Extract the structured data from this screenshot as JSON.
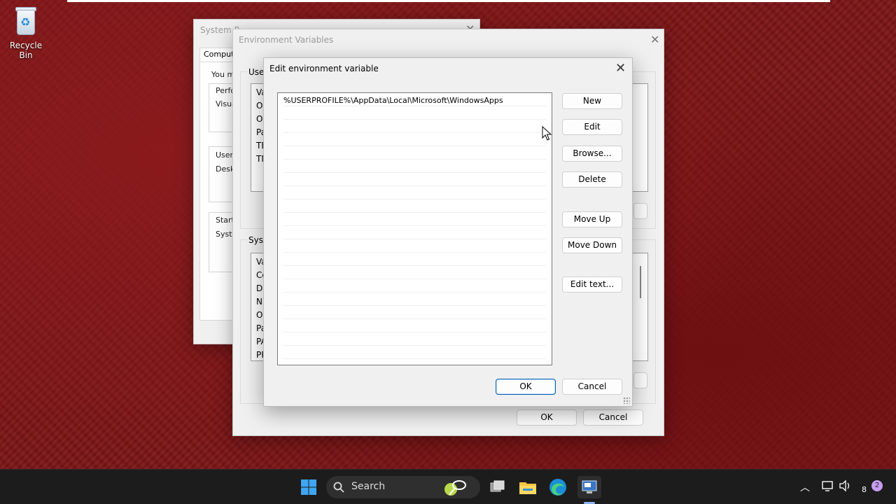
{
  "desktop": {
    "recycle_bin_label": "Recycle Bin"
  },
  "system_properties": {
    "title": "System P",
    "tab_computer": "Compute",
    "intro": "You m",
    "perf": "Perfo",
    "visual": "Visua",
    "user": "User",
    "desk": "Desk",
    "startup": "Startu",
    "system": "Syste"
  },
  "env_vars": {
    "title": "Environment Variables",
    "user_group_label": "User",
    "system_group_label": "Syste",
    "user_rows": [
      "Va",
      "Or",
      "Or",
      "Pa",
      "TE",
      "TM"
    ],
    "system_rows": [
      "Va",
      "Co",
      "Dr",
      "NU",
      "OS",
      "Pa",
      "PA",
      "PR"
    ],
    "ok": "OK",
    "cancel": "Cancel"
  },
  "edit_dialog": {
    "title": "Edit environment variable",
    "entries": [
      "%USERPROFILE%\\AppData\\Local\\Microsoft\\WindowsApps"
    ],
    "buttons": {
      "new": "New",
      "edit": "Edit",
      "browse": "Browse...",
      "delete": "Delete",
      "move_up": "Move Up",
      "move_down": "Move Down",
      "edit_text": "Edit text...",
      "ok": "OK",
      "cancel": "Cancel"
    }
  },
  "taskbar": {
    "search_label": "Search",
    "tray_number": "8",
    "notification_count": "2",
    "icons": [
      "windows-start-icon",
      "search-icon",
      "task-view-icon",
      "file-explorer-icon",
      "edge-icon",
      "control-panel-icon",
      "chevron-up-icon",
      "network-icon",
      "volume-icon"
    ]
  }
}
